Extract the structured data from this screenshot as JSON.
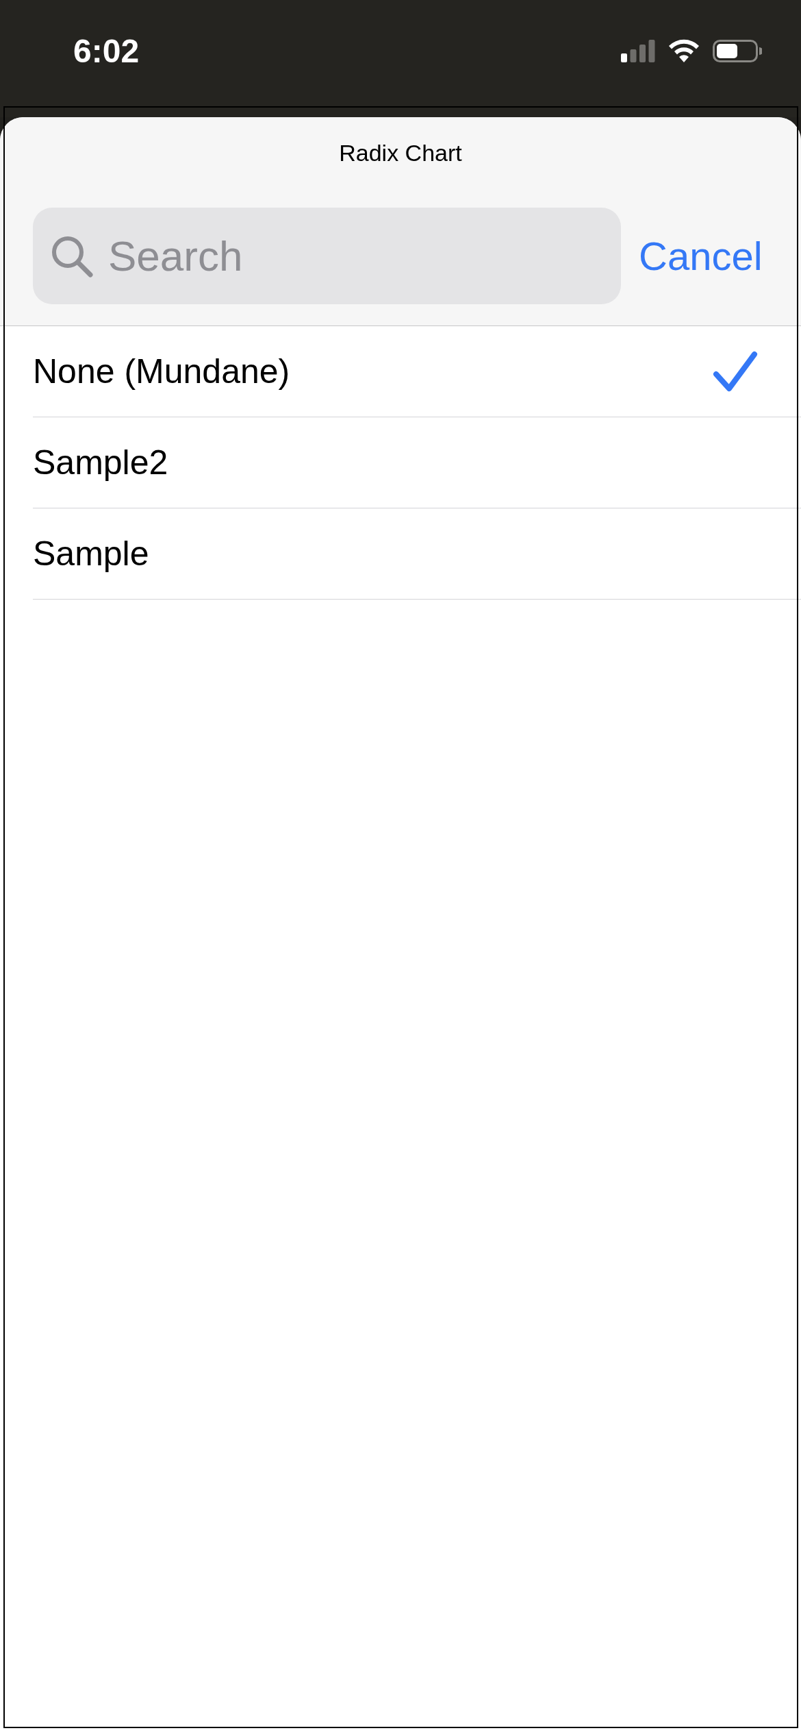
{
  "status_bar": {
    "time": "6:02"
  },
  "sheet": {
    "title": "Radix Chart",
    "search": {
      "placeholder": "Search"
    },
    "cancel": "Cancel"
  },
  "items": [
    {
      "label": "None (Mundane)",
      "selected": true
    },
    {
      "label": "Sample2",
      "selected": false
    },
    {
      "label": "Sample",
      "selected": false
    }
  ]
}
